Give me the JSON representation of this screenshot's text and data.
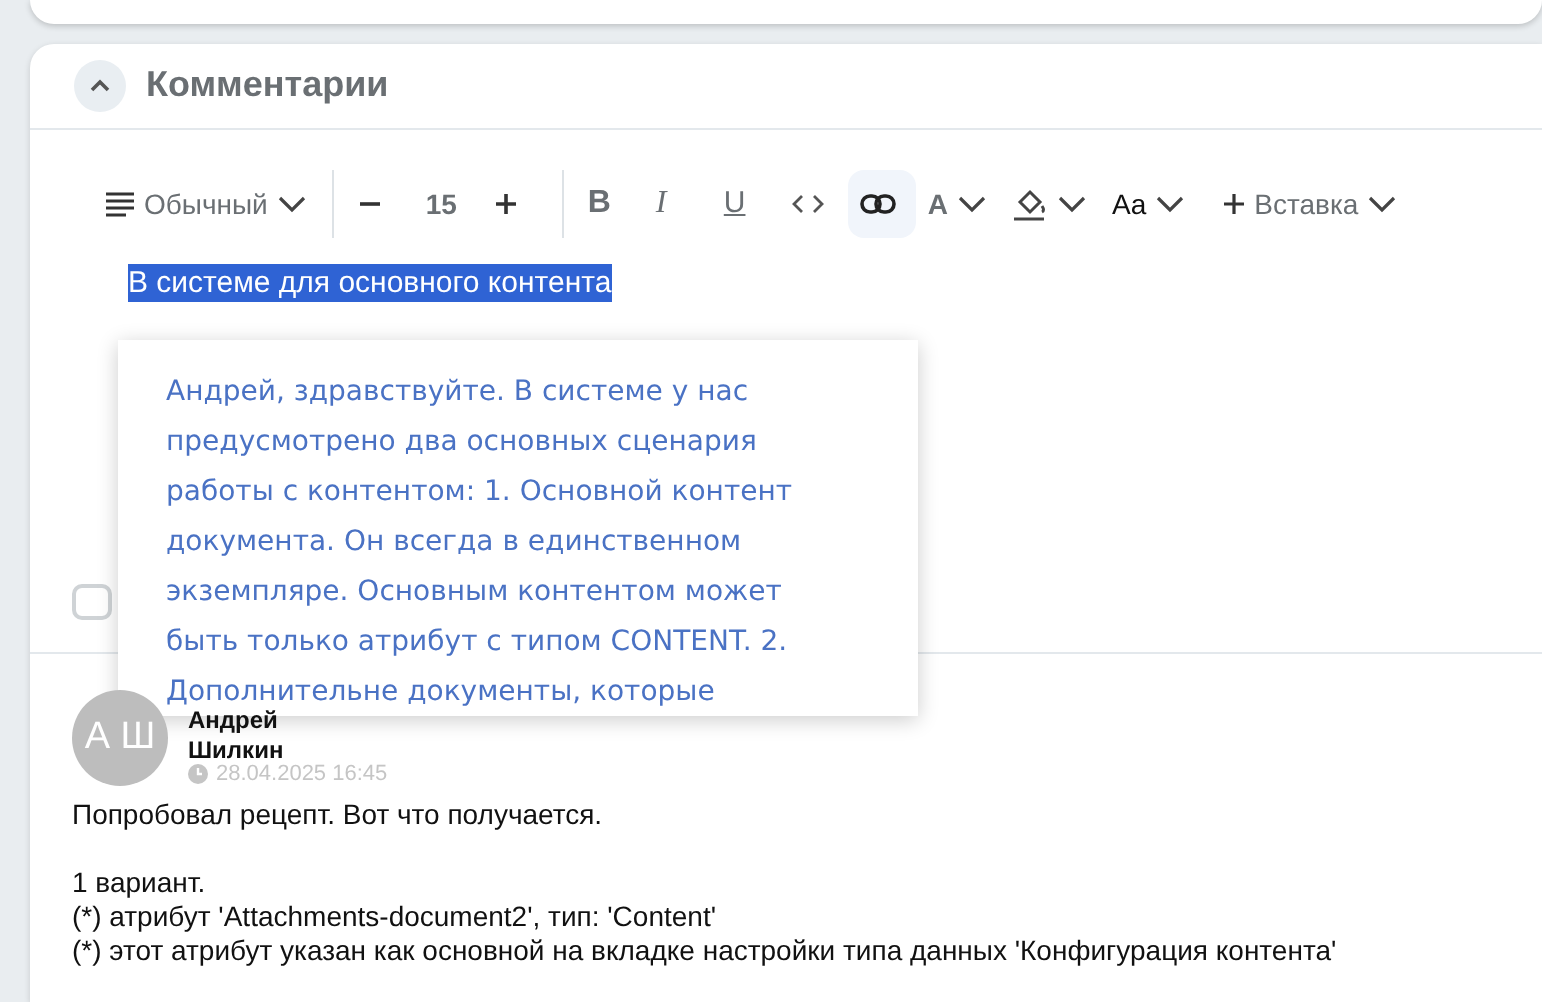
{
  "section": {
    "title": "Комментарии",
    "expanded": true
  },
  "toolbar": [
    {
      "kind": "format",
      "label": "Обычный"
    },
    {
      "kind": "separator"
    },
    {
      "kind": "size",
      "value": "15"
    },
    {
      "kind": "separator"
    },
    {
      "kind": "bold",
      "label": "B",
      "active": false
    },
    {
      "kind": "italic",
      "label": "I",
      "active": false
    },
    {
      "kind": "underline",
      "label": "U",
      "active": false
    },
    {
      "kind": "code",
      "active": false
    },
    {
      "kind": "link",
      "active": true
    },
    {
      "kind": "text-color",
      "label": "A"
    },
    {
      "kind": "fill-color"
    },
    {
      "kind": "case",
      "label": "Aa"
    },
    {
      "kind": "insert",
      "label": "Вставка"
    }
  ],
  "editor": {
    "selected_text": "В системе для основного контента",
    "checkbox_checked": false
  },
  "popup": {
    "text": "Андрей, здравствуйте. В системе у нас предусмотрено два основных сценария работы с контентом: 1. Основной контент документа. Он всегда в единственном экземпляре. Основным контентом может быть только атрибут с типом CONTENT. 2. Дополнительне документы, которые"
  },
  "comment": {
    "avatar": "А Ш",
    "author": "Андрей Шилкин",
    "date": "28.04.2025 16:45",
    "paragraphs": [
      [
        "Попробовал рецепт. Вот что получается."
      ],
      [
        "1 вариант.",
        "(*) атрибут 'Attachments-document2', тип: 'Content'",
        "(*) этот атрибут указан как основной на вкладке настройки типа данных 'Конфигурация контента'"
      ]
    ]
  }
}
